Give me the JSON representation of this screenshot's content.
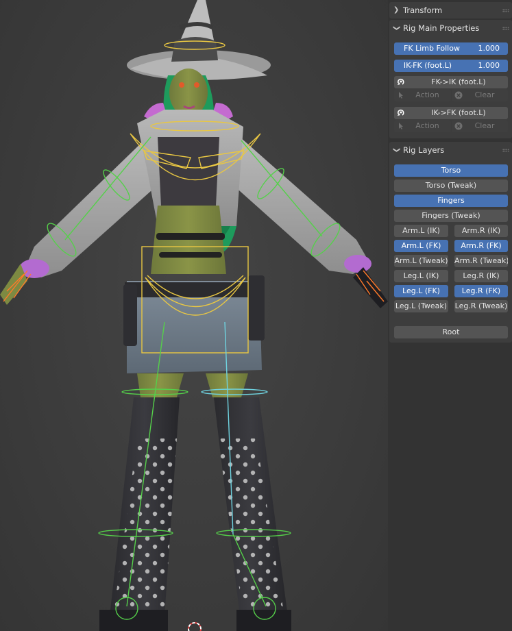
{
  "panels": {
    "transform": {
      "title": "Transform",
      "expanded": false
    },
    "rig_main": {
      "title": "Rig Main Properties",
      "expanded": true,
      "props": [
        {
          "label": "FK Limb Follow",
          "value": "1.000"
        },
        {
          "label": "IK-FK (foot.L)",
          "value": "1.000"
        }
      ],
      "ops": [
        {
          "label": "FK->IK (foot.L)",
          "action": "Action",
          "clear": "Clear"
        },
        {
          "label": "IK->FK (foot.L)",
          "action": "Action",
          "clear": "Clear"
        }
      ]
    },
    "rig_layers": {
      "title": "Rig Layers",
      "expanded": true,
      "full": [
        {
          "label": "Torso",
          "active": true
        },
        {
          "label": "Torso (Tweak)",
          "active": false
        },
        {
          "label": "Fingers",
          "active": true
        },
        {
          "label": "Fingers (Tweak)",
          "active": false
        }
      ],
      "pairs": [
        [
          {
            "label": "Arm.L (IK)",
            "active": false
          },
          {
            "label": "Arm.R (IK)",
            "active": false
          }
        ],
        [
          {
            "label": "Arm.L (FK)",
            "active": true
          },
          {
            "label": "Arm.R (FK)",
            "active": true
          }
        ],
        [
          {
            "label": "Arm.L (Tweak)",
            "active": false
          },
          {
            "label": "Arm.R (Tweak)",
            "active": false
          }
        ],
        [
          {
            "label": "Leg.L (IK)",
            "active": false
          },
          {
            "label": "Leg.R (IK)",
            "active": false
          }
        ],
        [
          {
            "label": "Leg.L (FK)",
            "active": true
          },
          {
            "label": "Leg.R (FK)",
            "active": true
          }
        ],
        [
          {
            "label": "Leg.L (Tweak)",
            "active": false
          },
          {
            "label": "Leg.R (Tweak)",
            "active": false
          }
        ]
      ],
      "root": {
        "label": "Root",
        "active": false
      }
    }
  },
  "colors": {
    "accent": "#4772b3",
    "button": "#545454",
    "panel": "#3d3d3d",
    "bone_fk": "#55d04a",
    "bone_torso": "#e9c743",
    "bone_ik_leg": "#6fd3e0",
    "bone_finger": "#ff7a2a"
  },
  "icons": {
    "collapse": "chevron-right-icon",
    "expand": "chevron-down-icon",
    "snap": "snap-arrow-icon",
    "action": "cursor-icon",
    "clear": "x-circle-icon",
    "cursor3d": "3d-cursor-icon"
  }
}
